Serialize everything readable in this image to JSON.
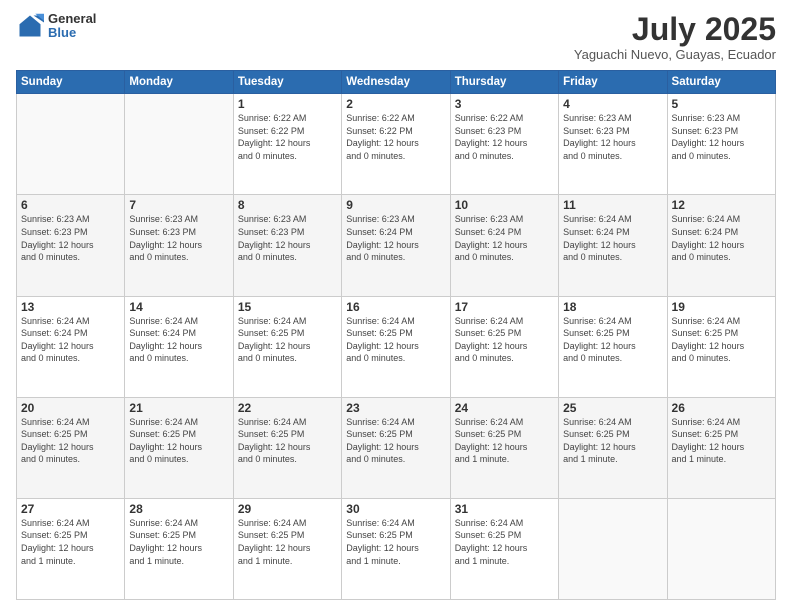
{
  "header": {
    "logo_general": "General",
    "logo_blue": "Blue",
    "month_title": "July 2025",
    "location": "Yaguachi Nuevo, Guayas, Ecuador"
  },
  "days_of_week": [
    "Sunday",
    "Monday",
    "Tuesday",
    "Wednesday",
    "Thursday",
    "Friday",
    "Saturday"
  ],
  "weeks": [
    [
      {
        "day": "",
        "info": ""
      },
      {
        "day": "",
        "info": ""
      },
      {
        "day": "1",
        "info": "Sunrise: 6:22 AM\nSunset: 6:22 PM\nDaylight: 12 hours\nand 0 minutes."
      },
      {
        "day": "2",
        "info": "Sunrise: 6:22 AM\nSunset: 6:22 PM\nDaylight: 12 hours\nand 0 minutes."
      },
      {
        "day": "3",
        "info": "Sunrise: 6:22 AM\nSunset: 6:23 PM\nDaylight: 12 hours\nand 0 minutes."
      },
      {
        "day": "4",
        "info": "Sunrise: 6:23 AM\nSunset: 6:23 PM\nDaylight: 12 hours\nand 0 minutes."
      },
      {
        "day": "5",
        "info": "Sunrise: 6:23 AM\nSunset: 6:23 PM\nDaylight: 12 hours\nand 0 minutes."
      }
    ],
    [
      {
        "day": "6",
        "info": "Sunrise: 6:23 AM\nSunset: 6:23 PM\nDaylight: 12 hours\nand 0 minutes."
      },
      {
        "day": "7",
        "info": "Sunrise: 6:23 AM\nSunset: 6:23 PM\nDaylight: 12 hours\nand 0 minutes."
      },
      {
        "day": "8",
        "info": "Sunrise: 6:23 AM\nSunset: 6:23 PM\nDaylight: 12 hours\nand 0 minutes."
      },
      {
        "day": "9",
        "info": "Sunrise: 6:23 AM\nSunset: 6:24 PM\nDaylight: 12 hours\nand 0 minutes."
      },
      {
        "day": "10",
        "info": "Sunrise: 6:23 AM\nSunset: 6:24 PM\nDaylight: 12 hours\nand 0 minutes."
      },
      {
        "day": "11",
        "info": "Sunrise: 6:24 AM\nSunset: 6:24 PM\nDaylight: 12 hours\nand 0 minutes."
      },
      {
        "day": "12",
        "info": "Sunrise: 6:24 AM\nSunset: 6:24 PM\nDaylight: 12 hours\nand 0 minutes."
      }
    ],
    [
      {
        "day": "13",
        "info": "Sunrise: 6:24 AM\nSunset: 6:24 PM\nDaylight: 12 hours\nand 0 minutes."
      },
      {
        "day": "14",
        "info": "Sunrise: 6:24 AM\nSunset: 6:24 PM\nDaylight: 12 hours\nand 0 minutes."
      },
      {
        "day": "15",
        "info": "Sunrise: 6:24 AM\nSunset: 6:25 PM\nDaylight: 12 hours\nand 0 minutes."
      },
      {
        "day": "16",
        "info": "Sunrise: 6:24 AM\nSunset: 6:25 PM\nDaylight: 12 hours\nand 0 minutes."
      },
      {
        "day": "17",
        "info": "Sunrise: 6:24 AM\nSunset: 6:25 PM\nDaylight: 12 hours\nand 0 minutes."
      },
      {
        "day": "18",
        "info": "Sunrise: 6:24 AM\nSunset: 6:25 PM\nDaylight: 12 hours\nand 0 minutes."
      },
      {
        "day": "19",
        "info": "Sunrise: 6:24 AM\nSunset: 6:25 PM\nDaylight: 12 hours\nand 0 minutes."
      }
    ],
    [
      {
        "day": "20",
        "info": "Sunrise: 6:24 AM\nSunset: 6:25 PM\nDaylight: 12 hours\nand 0 minutes."
      },
      {
        "day": "21",
        "info": "Sunrise: 6:24 AM\nSunset: 6:25 PM\nDaylight: 12 hours\nand 0 minutes."
      },
      {
        "day": "22",
        "info": "Sunrise: 6:24 AM\nSunset: 6:25 PM\nDaylight: 12 hours\nand 0 minutes."
      },
      {
        "day": "23",
        "info": "Sunrise: 6:24 AM\nSunset: 6:25 PM\nDaylight: 12 hours\nand 0 minutes."
      },
      {
        "day": "24",
        "info": "Sunrise: 6:24 AM\nSunset: 6:25 PM\nDaylight: 12 hours\nand 1 minute."
      },
      {
        "day": "25",
        "info": "Sunrise: 6:24 AM\nSunset: 6:25 PM\nDaylight: 12 hours\nand 1 minute."
      },
      {
        "day": "26",
        "info": "Sunrise: 6:24 AM\nSunset: 6:25 PM\nDaylight: 12 hours\nand 1 minute."
      }
    ],
    [
      {
        "day": "27",
        "info": "Sunrise: 6:24 AM\nSunset: 6:25 PM\nDaylight: 12 hours\nand 1 minute."
      },
      {
        "day": "28",
        "info": "Sunrise: 6:24 AM\nSunset: 6:25 PM\nDaylight: 12 hours\nand 1 minute."
      },
      {
        "day": "29",
        "info": "Sunrise: 6:24 AM\nSunset: 6:25 PM\nDaylight: 12 hours\nand 1 minute."
      },
      {
        "day": "30",
        "info": "Sunrise: 6:24 AM\nSunset: 6:25 PM\nDaylight: 12 hours\nand 1 minute."
      },
      {
        "day": "31",
        "info": "Sunrise: 6:24 AM\nSunset: 6:25 PM\nDaylight: 12 hours\nand 1 minute."
      },
      {
        "day": "",
        "info": ""
      },
      {
        "day": "",
        "info": ""
      }
    ]
  ]
}
